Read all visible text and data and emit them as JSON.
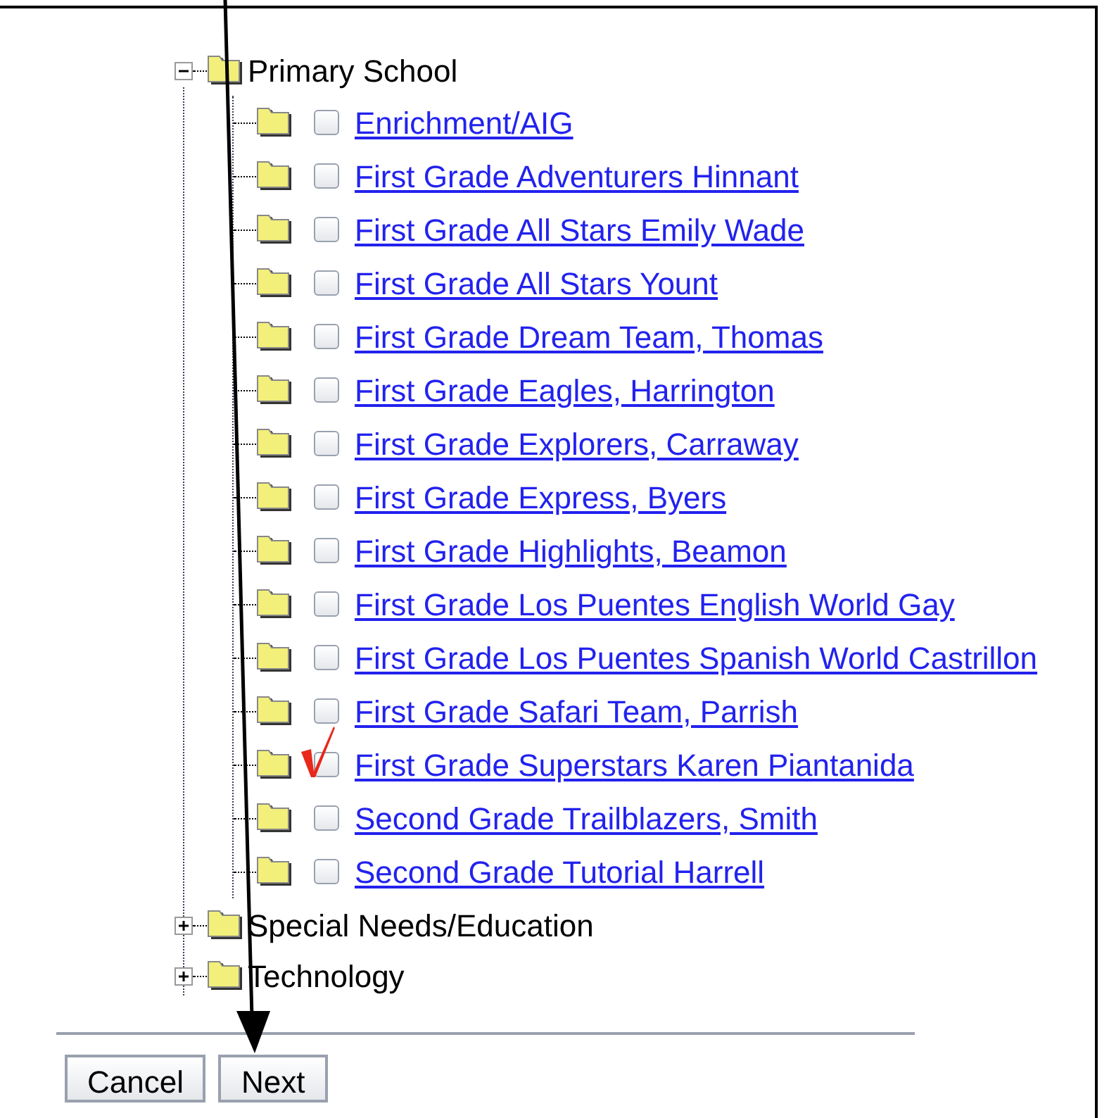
{
  "tree": [
    {
      "label": "Primary School",
      "expanded": true,
      "children": [
        {
          "label": "Enrichment/AIG",
          "checked": false,
          "marked": false
        },
        {
          "label": "First Grade Adventurers Hinnant",
          "checked": false,
          "marked": false
        },
        {
          "label": "First Grade All Stars Emily Wade",
          "checked": false,
          "marked": false
        },
        {
          "label": "First Grade All Stars Yount",
          "checked": false,
          "marked": false
        },
        {
          "label": "First Grade Dream Team, Thomas",
          "checked": false,
          "marked": false
        },
        {
          "label": "First Grade Eagles, Harrington",
          "checked": false,
          "marked": false
        },
        {
          "label": "First Grade Explorers, Carraway",
          "checked": false,
          "marked": false
        },
        {
          "label": "First Grade Express, Byers",
          "checked": false,
          "marked": false
        },
        {
          "label": "First Grade Highlights, Beamon",
          "checked": false,
          "marked": false
        },
        {
          "label": "First Grade Los Puentes English World Gay",
          "checked": false,
          "marked": false
        },
        {
          "label": "First Grade Los Puentes Spanish World Castrillon",
          "checked": false,
          "marked": false
        },
        {
          "label": "First Grade Safari Team, Parrish",
          "checked": false,
          "marked": false
        },
        {
          "label": "First Grade Superstars Karen Piantanida",
          "checked": false,
          "marked": true
        },
        {
          "label": "Second Grade Trailblazers, Smith",
          "checked": false,
          "marked": false
        },
        {
          "label": "Second Grade Tutorial Harrell",
          "checked": false,
          "marked": false
        }
      ]
    },
    {
      "label": "Special Needs/Education",
      "expanded": false
    },
    {
      "label": "Technology",
      "expanded": false
    }
  ],
  "buttons": [
    {
      "label": "Cancel"
    },
    {
      "label": "Next"
    }
  ]
}
